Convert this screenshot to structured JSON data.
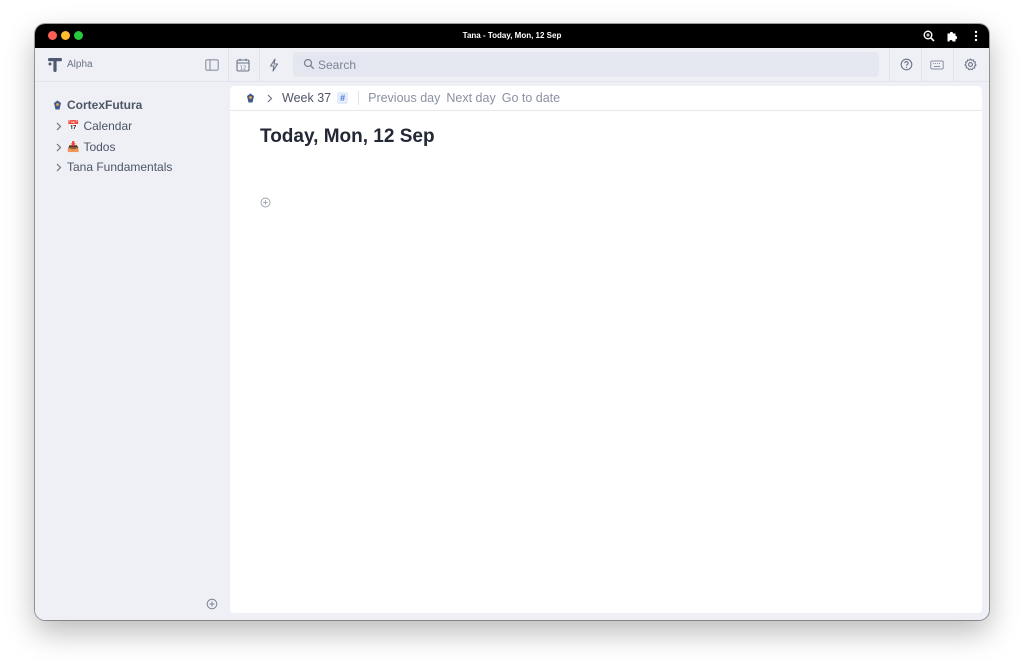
{
  "window": {
    "title": "Tana - Today, Mon, 12 Sep"
  },
  "toolbar": {
    "app_name": "Alpha",
    "search_placeholder": "Search"
  },
  "sidebar": {
    "workspace": "CortexFutura",
    "items": [
      {
        "emoji": "📅",
        "label": "Calendar"
      },
      {
        "emoji": "📥",
        "label": "Todos"
      },
      {
        "emoji": "",
        "label": "Tana Fundamentals"
      }
    ]
  },
  "breadcrumb": {
    "week": "Week 37",
    "tag": "#",
    "links": [
      "Previous day",
      "Next day",
      "Go to date"
    ]
  },
  "page": {
    "title": "Today, Mon, 12 Sep"
  },
  "icons": [
    "zoom-icon",
    "extension-icon",
    "more-icon",
    "sidebar-toggle-icon",
    "calendar-icon",
    "lightning-icon",
    "search-icon",
    "help-icon",
    "keyboard-icon",
    "settings-icon",
    "chevron-right-icon",
    "add-icon"
  ],
  "colors": {
    "titlebar": "#000000",
    "chrome": "#eef0f6",
    "panel": "#ffffff",
    "text": "#222836",
    "tag_bg": "#e5ecfb",
    "tag_fg": "#4a78d8"
  }
}
